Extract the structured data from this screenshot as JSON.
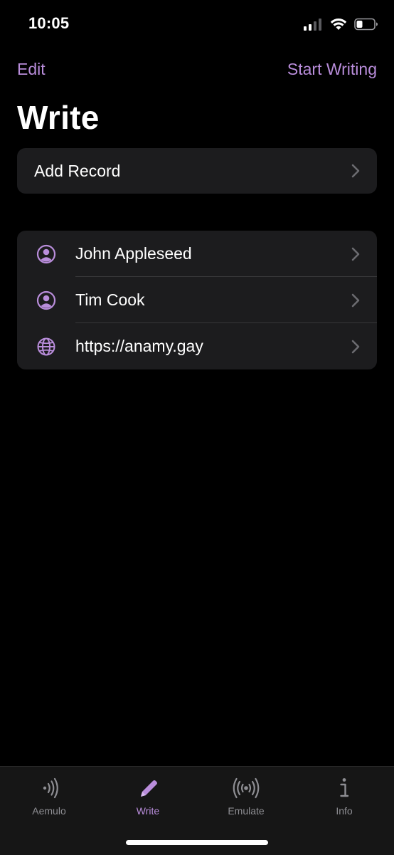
{
  "status_bar": {
    "time": "10:05"
  },
  "nav": {
    "left_label": "Edit",
    "right_label": "Start Writing"
  },
  "page_title": "Write",
  "add_group": {
    "label": "Add Record"
  },
  "records": [
    {
      "label": "John Appleseed",
      "icon": "person-circle-icon"
    },
    {
      "label": "Tim Cook",
      "icon": "person-circle-icon"
    },
    {
      "label": "https://anamy.gay",
      "icon": "globe-icon"
    }
  ],
  "tabs": [
    {
      "label": "Aemulo",
      "icon": "nfc-wave-icon",
      "active": false
    },
    {
      "label": "Write",
      "icon": "pencil-icon",
      "active": true
    },
    {
      "label": "Emulate",
      "icon": "broadcast-icon",
      "active": false
    },
    {
      "label": "Info",
      "icon": "info-icon",
      "active": false
    }
  ],
  "colors": {
    "accent": "#b98ddb",
    "background": "#000000",
    "cell": "#1c1c1e",
    "inactive_tab": "#8e8e93"
  }
}
